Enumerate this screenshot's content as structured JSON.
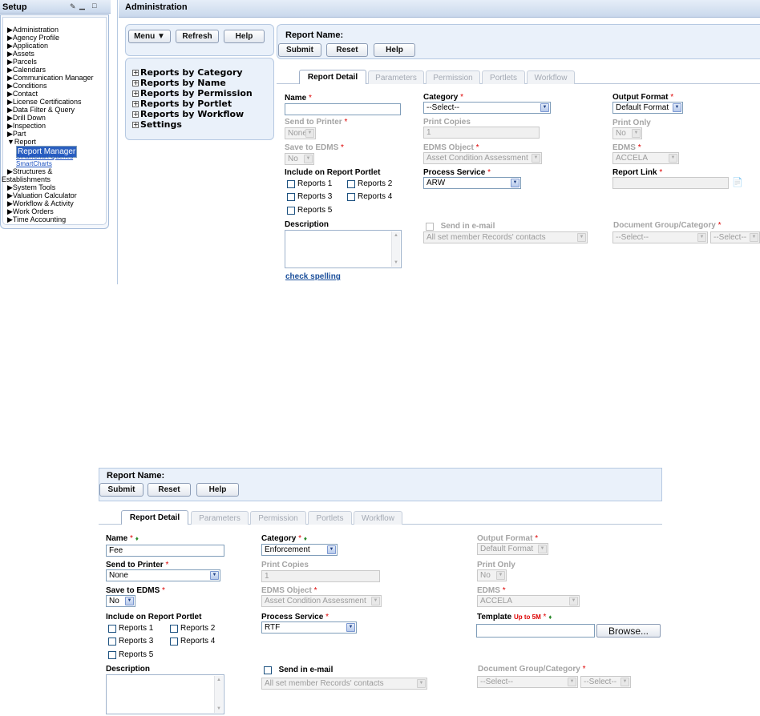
{
  "setup": {
    "title": "Setup",
    "nav": [
      {
        "label": "▶Administration"
      },
      {
        "label": "▶Agency Profile"
      },
      {
        "label": "▶Application"
      },
      {
        "label": "▶Assets"
      },
      {
        "label": "▶Parcels"
      },
      {
        "label": "▶Calendars"
      },
      {
        "label": "▶Communication Manager"
      },
      {
        "label": "▶Conditions"
      },
      {
        "label": "▶Contact"
      },
      {
        "label": "▶License Certifications"
      },
      {
        "label": "▶Data Filter & Query"
      },
      {
        "label": "▶Drill Down"
      },
      {
        "label": "▶Inspection"
      },
      {
        "label": "▶Part"
      },
      {
        "label": "▼Report"
      }
    ],
    "report_sub": [
      {
        "label": "Report Manager"
      },
      {
        "label": "SmartChart Queries"
      },
      {
        "label": "SmartCharts"
      }
    ],
    "nav2": [
      {
        "label": "▶Structures &"
      },
      {
        "label": "Establishments"
      },
      {
        "label": "▶System Tools"
      },
      {
        "label": "▶Valuation Calculator"
      },
      {
        "label": "▶Workflow & Activity"
      },
      {
        "label": "▶Work Orders"
      },
      {
        "label": "▶Time Accounting"
      }
    ]
  },
  "admin": {
    "title": "Administration",
    "menu_label": "Menu ▼",
    "refresh_label": "Refresh",
    "help_label": "Help",
    "tree": [
      {
        "label": "Reports by Category"
      },
      {
        "label": "Reports by Name"
      },
      {
        "label": "Reports by Permission"
      },
      {
        "label": "Reports by Portlet"
      },
      {
        "label": "Reports by Workflow"
      },
      {
        "label": "Settings"
      }
    ]
  },
  "form_top": {
    "report_name_label": "Report Name:",
    "submit": "Submit",
    "reset": "Reset",
    "help": "Help",
    "tabs": [
      "Report Detail",
      "Parameters",
      "Permission",
      "Portlets",
      "Workflow"
    ],
    "name_label": "Name",
    "name_value": "",
    "category_label": "Category",
    "category_value": "--Select--",
    "output_label": "Output Format",
    "output_value": "Default Format",
    "send_printer_label": "Send to Printer",
    "send_printer_value": "None",
    "print_copies_label": "Print Copies",
    "print_copies_value": "1",
    "print_only_label": "Print Only",
    "print_only_value": "No",
    "save_edms_label": "Save to EDMS",
    "save_edms_value": "No",
    "edms_object_label": "EDMS Object",
    "edms_object_value": "Asset Condition Assessment",
    "edms_label": "EDMS",
    "edms_value": "ACCELA",
    "portlet_label": "Include on Report Portlet",
    "reports": [
      "Reports 1",
      "Reports 2",
      "Reports 3",
      "Reports 4",
      "Reports 5"
    ],
    "process_label": "Process Service",
    "process_value": "ARW",
    "report_link_label": "Report Link",
    "description_label": "Description",
    "send_email_label": "Send in e-mail",
    "email_value": "All set member Records' contacts",
    "doc_group_label": "Document Group/Category",
    "doc_group_value": "--Select--",
    "doc_cat_value": "--Select--",
    "spell_label": "check spelling"
  },
  "form_bottom": {
    "report_name_label": "Report Name:",
    "submit": "Submit",
    "reset": "Reset",
    "help": "Help",
    "tabs": [
      "Report Detail",
      "Parameters",
      "Permission",
      "Portlets",
      "Workflow"
    ],
    "name_label": "Name",
    "name_value": "Fee",
    "category_label": "Category",
    "category_value": "Enforcement",
    "output_label": "Output Format",
    "output_value": "Default Format",
    "send_printer_label": "Send to Printer",
    "send_printer_value": "None",
    "print_copies_label": "Print Copies",
    "print_copies_value": "1",
    "print_only_label": "Print Only",
    "print_only_value": "No",
    "save_edms_label": "Save to EDMS",
    "save_edms_value": "No",
    "edms_object_label": "EDMS Object",
    "edms_object_value": "Asset Condition Assessment",
    "edms_label": "EDMS",
    "edms_value": "ACCELA",
    "portlet_label": "Include on Report Portlet",
    "reports": [
      "Reports 1",
      "Reports 2",
      "Reports 3",
      "Reports 4",
      "Reports 5"
    ],
    "process_label": "Process Service",
    "process_value": "RTF",
    "template_label": "Template",
    "template_note": "Up to 5M",
    "browse_label": "Browse...",
    "description_label": "Description",
    "send_email_label": "Send in e-mail",
    "email_value": "All set member Records' contacts",
    "doc_group_label": "Document Group/Category",
    "doc_group_value": "--Select--",
    "doc_cat_value": "--Select--"
  }
}
